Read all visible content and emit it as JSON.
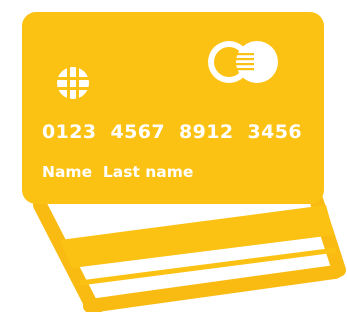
{
  "card": {
    "number": "0123  4567  8912  3456",
    "holder_name": "Name  Last name"
  },
  "icons": {
    "chip": "chip-icon",
    "logo": "card-network-logo-icon"
  },
  "colors": {
    "card_yellow": "#fcc213",
    "back_card_outline": "#f9bb12",
    "text_white": "#ffffff"
  }
}
